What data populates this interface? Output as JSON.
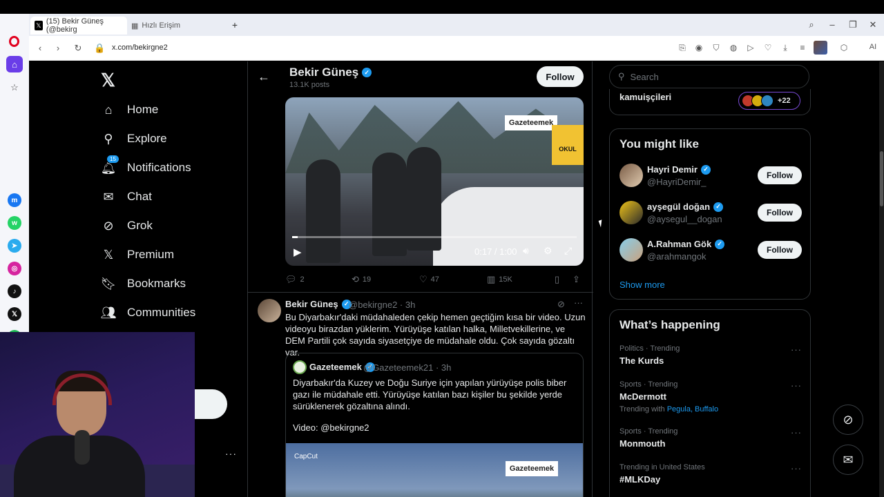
{
  "browser": {
    "tabs": [
      {
        "label": "(15) Bekir Güneş (@bekirg",
        "icon": "x-icon"
      },
      {
        "label": "Hızlı Erişim",
        "icon": "grid-icon"
      }
    ],
    "url": "x.com/bekirgne2",
    "ai_label": "AI"
  },
  "nav": {
    "items": [
      {
        "label": "Home",
        "icon": "home-icon"
      },
      {
        "label": "Explore",
        "icon": "search-icon"
      },
      {
        "label": "Notifications",
        "icon": "bell-icon",
        "badge": "15"
      },
      {
        "label": "Chat",
        "icon": "mail-icon"
      },
      {
        "label": "Grok",
        "icon": "grok-icon"
      },
      {
        "label": "Premium",
        "icon": "x-icon"
      },
      {
        "label": "Bookmarks",
        "icon": "bookmark-icon"
      },
      {
        "label": "Communities",
        "icon": "people-icon"
      }
    ],
    "more": "···"
  },
  "profile_header": {
    "name": "Bekir Güneş",
    "posts": "13.1K posts",
    "follow": "Follow"
  },
  "video1": {
    "time": "0:17 / 1:00",
    "progress": 0.02,
    "watermark": "Gazeteemek",
    "truck_label": "OKUL"
  },
  "tweet1_actions": {
    "replies": "2",
    "reposts": "19",
    "likes": "47",
    "views": "15K"
  },
  "tweet2": {
    "name": "Bekir Güneş",
    "handle": "@bekirgne2 · 3h",
    "text": "Bu Diyarbakır'daki müdahaleden çekip hemen geçtiğim kısa bir video. Uzun videoyu birazdan yüklerim. Yürüyüşe katılan halka, Milletvekillerine, ve DEM Partili çok sayıda siyasetçiye de müdahale oldu. Çok sayıda gözaltı var.",
    "quote": {
      "name": "Gazeteemek",
      "handle": "@Gazeteemek21 · 3h",
      "text": "Diyarbakır'da Kuzey ve Doğu Suriye için yapılan yürüyüşe polis biber gazı ile müdahale etti. Yürüyüşe katılan bazı kişiler bu şekilde yerde sürüklenerek gözaltına alındı.",
      "text2": "Video: @bekirgne2",
      "watermark": "Gazeteemek",
      "capcut": "CapCut"
    }
  },
  "right": {
    "search_placeholder": "Search",
    "top_card_title": "kamuişçileri",
    "facepile_count": "+22",
    "you_might_like": {
      "title": "You might like",
      "users": [
        {
          "name": "Hayri Demir",
          "handle": "@HayriDemir_",
          "follow": "Follow"
        },
        {
          "name": "ayşegül doğan",
          "handle": "@aysegul__dogan",
          "follow": "Follow"
        },
        {
          "name": "A.Rahman Gök",
          "handle": "@arahmangok",
          "follow": "Follow"
        }
      ],
      "show_more": "Show more"
    },
    "whats_happening": {
      "title": "What’s happening",
      "trends": [
        {
          "meta": "Politics · Trending",
          "name": "The Kurds",
          "extra": "",
          "links": ""
        },
        {
          "meta": "Sports · Trending",
          "name": "McDermott",
          "extra": "Trending with",
          "links": "Pegula, Buffalo"
        },
        {
          "meta": "Sports · Trending",
          "name": "Monmouth",
          "extra": "",
          "links": ""
        },
        {
          "meta": "Trending in United States",
          "name": "#MLKDay",
          "extra": "",
          "links": ""
        }
      ]
    }
  },
  "colors": {
    "accent": "#1d9bf0",
    "background": "#000000",
    "text": "#e7e9ea",
    "muted": "#71767b",
    "opera_red": "#e1001e"
  }
}
